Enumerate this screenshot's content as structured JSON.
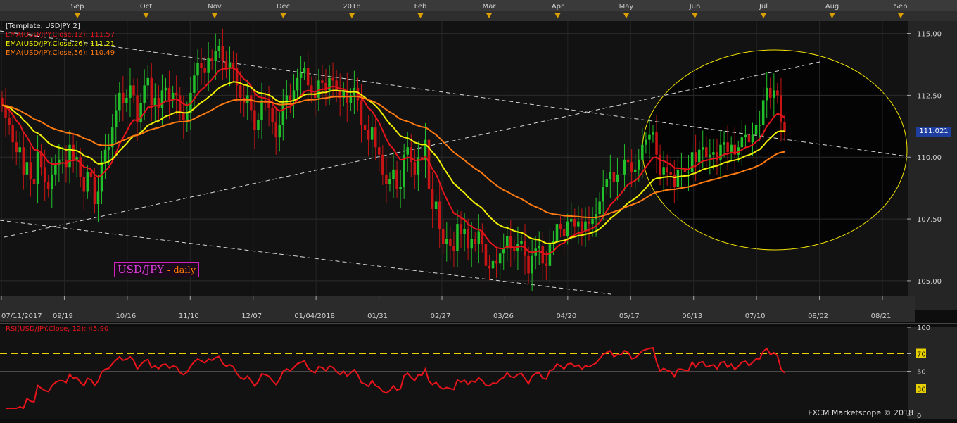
{
  "chart_data": [
    {
      "type": "candlestick",
      "top_months": [
        "Sep",
        "Oct",
        "Nov",
        "Dec",
        "2018",
        "Feb",
        "Mar",
        "Apr",
        "May",
        "Jun",
        "Jul",
        "Aug",
        "Sep"
      ],
      "template_label": "[Template: USDJPY 2]",
      "indicators": [
        {
          "label": "EMA(USD/JPY.Close,12):",
          "value": "111.57",
          "color": "#e8141c"
        },
        {
          "label": "EMA(USD/JPY.Close,26):",
          "value": "111.21",
          "color": "#f0f000"
        },
        {
          "label": "EMA(USD/JPY.Close,56):",
          "value": "110.49",
          "color": "#ff7a10"
        }
      ],
      "y_ticks": [
        "115.00",
        "112.50",
        "110.00",
        "107.50",
        "105.00"
      ],
      "ylim": [
        104.4,
        115.5
      ],
      "x_tick_labels": [
        "07/11/2017",
        "09/19",
        "10/16",
        "11/10",
        "12/07",
        "01/04/2018",
        "01/31",
        "02/27",
        "03/26",
        "04/20",
        "05/17",
        "06/13",
        "07/10",
        "08/02",
        "08/21"
      ],
      "current_price": "111.021",
      "legend_title": "USD/JPY",
      "legend_sub": "- daily",
      "close_series": [
        112.1,
        111.6,
        111.3,
        110.6,
        110.2,
        110.4,
        109.3,
        109.8,
        109.1,
        108.9,
        110.2,
        109.6,
        109.0,
        108.7,
        109.3,
        109.7,
        109.9,
        109.9,
        109.6,
        110.5,
        109.9,
        110.0,
        109.2,
        108.6,
        109.4,
        109.2,
        108.1,
        108.6,
        109.8,
        110.3,
        110.4,
        111.2,
        111.9,
        112.6,
        112.2,
        112.4,
        112.9,
        112.5,
        111.4,
        112.2,
        112.9,
        113.2,
        112.1,
        112.4,
        112.0,
        112.7,
        112.8,
        112.3,
        112.6,
        112.5,
        111.8,
        111.5,
        111.8,
        112.6,
        113.3,
        113.8,
        113.6,
        113.4,
        114.0,
        113.9,
        114.3,
        114.5,
        113.9,
        113.6,
        113.8,
        113.6,
        112.9,
        112.4,
        112.2,
        112.5,
        111.9,
        111.1,
        111.5,
        112.3,
        112.2,
        112.0,
        111.4,
        110.8,
        111.3,
        112.2,
        112.5,
        112.3,
        112.7,
        113.2,
        113.4,
        113.6,
        112.9,
        112.6,
        112.4,
        113.1,
        113.0,
        112.7,
        113.2,
        113.1,
        112.7,
        112.4,
        112.7,
        112.2,
        112.5,
        112.8,
        112.3,
        111.3,
        111.1,
        110.7,
        111.2,
        110.4,
        110.1,
        109.3,
        108.9,
        109.1,
        109.5,
        108.7,
        108.8,
        110.1,
        110.4,
        109.8,
        109.3,
        110.0,
        109.9,
        110.7,
        108.7,
        107.9,
        108.2,
        107.1,
        106.5,
        106.7,
        106.4,
        106.2,
        107.3,
        106.9,
        107.1,
        106.3,
        106.7,
        106.5,
        107.0,
        106.5,
        105.6,
        105.5,
        105.8,
        105.7,
        106.1,
        106.3,
        106.8,
        106.3,
        106.2,
        106.5,
        106.6,
        106.0,
        105.3,
        106.0,
        106.3,
        106.4,
        105.7,
        105.6,
        106.5,
        106.6,
        107.3,
        107.1,
        106.8,
        107.4,
        107.5,
        107.2,
        107.4,
        107.0,
        107.4,
        107.3,
        107.5,
        107.7,
        108.2,
        108.8,
        109.1,
        109.4,
        109.0,
        109.3,
        109.3,
        109.9,
        109.8,
        109.4,
        109.5,
        109.9,
        110.5,
        110.7,
        110.9,
        111.0,
        110.1,
        109.3,
        109.6,
        109.4,
        109.3,
        108.8,
        109.5,
        109.5,
        109.4,
        109.4,
        110.2,
        109.8,
        110.3,
        110.4,
        110.0,
        110.1,
        110.2,
        109.9,
        110.5,
        110.6,
        110.2,
        110.5,
        110.1,
        110.4,
        110.8,
        110.9,
        110.6,
        110.9,
        111.3,
        111.3,
        112.3,
        112.8,
        112.4,
        112.7,
        112.5,
        111.4,
        111.0
      ]
    },
    {
      "type": "line",
      "label": "RSI(USD/JPY.Close, 12): 45.90",
      "y_ticks": [
        "100",
        "70",
        "50",
        "30",
        "0"
      ],
      "ylim": [
        0,
        100
      ],
      "watermark": "FXCM Marketscope © 2018"
    }
  ]
}
